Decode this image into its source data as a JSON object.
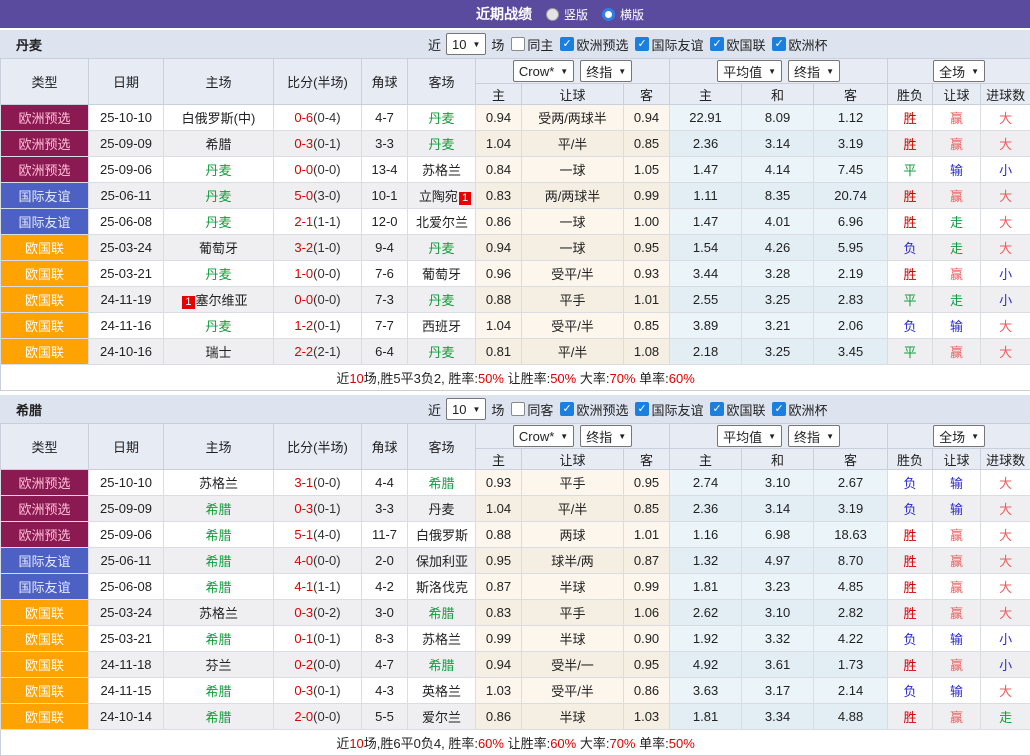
{
  "topbar": {
    "title": "近期战绩",
    "vertical_label": "竖版",
    "horizontal_label": "横版",
    "selected_layout": "横版"
  },
  "filter": {
    "near": "近",
    "count": "10",
    "games": "场",
    "leagues": [
      "欧洲预选",
      "国际友谊",
      "欧国联",
      "欧洲杯"
    ],
    "leagues_checked": [
      true,
      true,
      true,
      true
    ]
  },
  "dropdowns": {
    "source": "Crow*",
    "final": "终指",
    "average": "平均值",
    "final2": "终指",
    "scope": "全场"
  },
  "columns": {
    "type": "类型",
    "date": "日期",
    "home": "主场",
    "score": "比分(半场)",
    "corner": "角球",
    "away": "客场",
    "home_odds": "主",
    "handicap": "让球",
    "away_odds": "客",
    "avg_home": "主",
    "avg_draw": "和",
    "avg_away": "客",
    "result": "胜负",
    "handicap_result": "让球",
    "goals": "进球数"
  },
  "colors": {
    "accent_purple": "#5b4b9e",
    "type_preselect": "#8c1a52",
    "type_friendly": "#4c61c3",
    "type_nations": "#ffa302",
    "win_red": "#d30000",
    "soft_red": "#ed5f5f",
    "lose_blue": "#2a2ace",
    "draw_green": "#0f9e3c",
    "checkbox_blue": "#1b7fe0"
  },
  "sections": [
    {
      "team": "丹麦",
      "same_venue_label": "同主",
      "same_venue_checked": false,
      "rows": [
        {
          "type": "欧洲预选",
          "tc": "ps",
          "date": "25-10-10",
          "home": "白俄罗斯(中)",
          "hg": 0,
          "score": "0-6",
          "half": "(0-4)",
          "corner": "4-7",
          "away": "丹麦",
          "ag": 1,
          "o1": "0.94",
          "line": "受两/两球半",
          "o2": "0.94",
          "m1": "22.91",
          "m2": "8.09",
          "m3": "1.12",
          "res": [
            "胜",
            "red"
          ],
          "hres": [
            "赢",
            "pink"
          ],
          "goal": [
            "大",
            "pink"
          ]
        },
        {
          "type": "欧洲预选",
          "tc": "ps",
          "date": "25-09-09",
          "home": "希腊",
          "hg": 0,
          "score": "0-3",
          "half": "(0-1)",
          "corner": "3-3",
          "away": "丹麦",
          "ag": 1,
          "o1": "1.04",
          "line": "平/半",
          "o2": "0.85",
          "m1": "2.36",
          "m2": "3.14",
          "m3": "3.19",
          "res": [
            "胜",
            "red"
          ],
          "hres": [
            "赢",
            "pink"
          ],
          "goal": [
            "大",
            "pink"
          ]
        },
        {
          "type": "欧洲预选",
          "tc": "ps",
          "date": "25-09-06",
          "home": "丹麦",
          "hg": 1,
          "score": "0-0",
          "half": "(0-0)",
          "corner": "13-4",
          "away": "苏格兰",
          "ag": 0,
          "o1": "0.84",
          "line": "一球",
          "o2": "1.05",
          "m1": "1.47",
          "m2": "4.14",
          "m3": "7.45",
          "res": [
            "平",
            "green"
          ],
          "hres": [
            "输",
            "blue"
          ],
          "goal": [
            "小",
            "blue"
          ]
        },
        {
          "type": "国际友谊",
          "tc": "fr",
          "date": "25-06-11",
          "home": "丹麦",
          "hg": 1,
          "score": "5-0",
          "half": "(3-0)",
          "corner": "10-1",
          "away": "立陶宛",
          "ag": 0,
          "ab": "1",
          "abp": "after",
          "o1": "0.83",
          "line": "两/两球半",
          "o2": "0.99",
          "m1": "1.11",
          "m2": "8.35",
          "m3": "20.74",
          "res": [
            "胜",
            "red"
          ],
          "hres": [
            "赢",
            "pink"
          ],
          "goal": [
            "大",
            "pink"
          ]
        },
        {
          "type": "国际友谊",
          "tc": "fr",
          "date": "25-06-08",
          "home": "丹麦",
          "hg": 1,
          "score": "2-1",
          "half": "(1-1)",
          "corner": "12-0",
          "away": "北爱尔兰",
          "ag": 0,
          "o1": "0.86",
          "line": "一球",
          "o2": "1.00",
          "m1": "1.47",
          "m2": "4.01",
          "m3": "6.96",
          "res": [
            "胜",
            "red"
          ],
          "hres": [
            "走",
            "green"
          ],
          "goal": [
            "大",
            "pink"
          ]
        },
        {
          "type": "欧国联",
          "tc": "nl",
          "date": "25-03-24",
          "home": "葡萄牙",
          "hg": 0,
          "score": "3-2",
          "half": "(1-0)",
          "corner": "9-4",
          "away": "丹麦",
          "ag": 1,
          "o1": "0.94",
          "line": "一球",
          "o2": "0.95",
          "m1": "1.54",
          "m2": "4.26",
          "m3": "5.95",
          "res": [
            "负",
            "blue"
          ],
          "hres": [
            "走",
            "green"
          ],
          "goal": [
            "大",
            "pink"
          ]
        },
        {
          "type": "欧国联",
          "tc": "nl",
          "date": "25-03-21",
          "home": "丹麦",
          "hg": 1,
          "score": "1-0",
          "half": "(0-0)",
          "corner": "7-6",
          "away": "葡萄牙",
          "ag": 0,
          "o1": "0.96",
          "line": "受平/半",
          "o2": "0.93",
          "m1": "3.44",
          "m2": "3.28",
          "m3": "2.19",
          "res": [
            "胜",
            "red"
          ],
          "hres": [
            "赢",
            "pink"
          ],
          "goal": [
            "小",
            "blue"
          ]
        },
        {
          "type": "欧国联",
          "tc": "nl",
          "date": "24-11-19",
          "home": "塞尔维亚",
          "hg": 0,
          "hb": "1",
          "hbp": "before",
          "score": "0-0",
          "half": "(0-0)",
          "corner": "7-3",
          "away": "丹麦",
          "ag": 1,
          "o1": "0.88",
          "line": "平手",
          "o2": "1.01",
          "m1": "2.55",
          "m2": "3.25",
          "m3": "2.83",
          "res": [
            "平",
            "green"
          ],
          "hres": [
            "走",
            "green"
          ],
          "goal": [
            "小",
            "blue"
          ]
        },
        {
          "type": "欧国联",
          "tc": "nl",
          "date": "24-11-16",
          "home": "丹麦",
          "hg": 1,
          "score": "1-2",
          "half": "(0-1)",
          "corner": "7-7",
          "away": "西班牙",
          "ag": 0,
          "o1": "1.04",
          "line": "受平/半",
          "o2": "0.85",
          "m1": "3.89",
          "m2": "3.21",
          "m3": "2.06",
          "res": [
            "负",
            "blue"
          ],
          "hres": [
            "输",
            "blue"
          ],
          "goal": [
            "大",
            "pink"
          ]
        },
        {
          "type": "欧国联",
          "tc": "nl",
          "date": "24-10-16",
          "home": "瑞士",
          "hg": 0,
          "score": "2-2",
          "half": "(2-1)",
          "corner": "6-4",
          "away": "丹麦",
          "ag": 1,
          "o1": "0.81",
          "line": "平/半",
          "o2": "1.08",
          "m1": "2.18",
          "m2": "3.25",
          "m3": "3.45",
          "res": [
            "平",
            "green"
          ],
          "hres": [
            "赢",
            "pink"
          ],
          "goal": [
            "大",
            "pink"
          ]
        }
      ],
      "summary": [
        [
          "近",
          "k"
        ],
        [
          "10",
          "r"
        ],
        [
          "场,胜5平3负2, 胜率:",
          "k"
        ],
        [
          "50%",
          "r"
        ],
        [
          " 让胜率:",
          "k"
        ],
        [
          "50%",
          "r"
        ],
        [
          " 大率:",
          "k"
        ],
        [
          "70%",
          "r"
        ],
        [
          " 单率:",
          "k"
        ],
        [
          "60%",
          "r"
        ]
      ]
    },
    {
      "team": "希腊",
      "same_venue_label": "同客",
      "same_venue_checked": false,
      "rows": [
        {
          "type": "欧洲预选",
          "tc": "ps",
          "date": "25-10-10",
          "home": "苏格兰",
          "hg": 0,
          "score": "3-1",
          "half": "(0-0)",
          "corner": "4-4",
          "away": "希腊",
          "ag": 1,
          "o1": "0.93",
          "line": "平手",
          "o2": "0.95",
          "m1": "2.74",
          "m2": "3.10",
          "m3": "2.67",
          "res": [
            "负",
            "blue"
          ],
          "hres": [
            "输",
            "blue"
          ],
          "goal": [
            "大",
            "pink"
          ]
        },
        {
          "type": "欧洲预选",
          "tc": "ps",
          "date": "25-09-09",
          "home": "希腊",
          "hg": 1,
          "score": "0-3",
          "half": "(0-1)",
          "corner": "3-3",
          "away": "丹麦",
          "ag": 0,
          "o1": "1.04",
          "line": "平/半",
          "o2": "0.85",
          "m1": "2.36",
          "m2": "3.14",
          "m3": "3.19",
          "res": [
            "负",
            "blue"
          ],
          "hres": [
            "输",
            "blue"
          ],
          "goal": [
            "大",
            "pink"
          ]
        },
        {
          "type": "欧洲预选",
          "tc": "ps",
          "date": "25-09-06",
          "home": "希腊",
          "hg": 1,
          "score": "5-1",
          "half": "(4-0)",
          "corner": "11-7",
          "away": "白俄罗斯",
          "ag": 0,
          "o1": "0.88",
          "line": "两球",
          "o2": "1.01",
          "m1": "1.16",
          "m2": "6.98",
          "m3": "18.63",
          "res": [
            "胜",
            "red"
          ],
          "hres": [
            "赢",
            "pink"
          ],
          "goal": [
            "大",
            "pink"
          ]
        },
        {
          "type": "国际友谊",
          "tc": "fr",
          "date": "25-06-11",
          "home": "希腊",
          "hg": 1,
          "score": "4-0",
          "half": "(0-0)",
          "corner": "2-0",
          "away": "保加利亚",
          "ag": 0,
          "o1": "0.95",
          "line": "球半/两",
          "o2": "0.87",
          "m1": "1.32",
          "m2": "4.97",
          "m3": "8.70",
          "res": [
            "胜",
            "red"
          ],
          "hres": [
            "赢",
            "pink"
          ],
          "goal": [
            "大",
            "pink"
          ]
        },
        {
          "type": "国际友谊",
          "tc": "fr",
          "date": "25-06-08",
          "home": "希腊",
          "hg": 1,
          "score": "4-1",
          "half": "(1-1)",
          "corner": "4-2",
          "away": "斯洛伐克",
          "ag": 0,
          "o1": "0.87",
          "line": "半球",
          "o2": "0.99",
          "m1": "1.81",
          "m2": "3.23",
          "m3": "4.85",
          "res": [
            "胜",
            "red"
          ],
          "hres": [
            "赢",
            "pink"
          ],
          "goal": [
            "大",
            "pink"
          ]
        },
        {
          "type": "欧国联",
          "tc": "nl",
          "date": "25-03-24",
          "home": "苏格兰",
          "hg": 0,
          "score": "0-3",
          "half": "(0-2)",
          "corner": "3-0",
          "away": "希腊",
          "ag": 1,
          "o1": "0.83",
          "line": "平手",
          "o2": "1.06",
          "m1": "2.62",
          "m2": "3.10",
          "m3": "2.82",
          "res": [
            "胜",
            "red"
          ],
          "hres": [
            "赢",
            "pink"
          ],
          "goal": [
            "大",
            "pink"
          ]
        },
        {
          "type": "欧国联",
          "tc": "nl",
          "date": "25-03-21",
          "home": "希腊",
          "hg": 1,
          "score": "0-1",
          "half": "(0-1)",
          "corner": "8-3",
          "away": "苏格兰",
          "ag": 0,
          "o1": "0.99",
          "line": "半球",
          "o2": "0.90",
          "m1": "1.92",
          "m2": "3.32",
          "m3": "4.22",
          "res": [
            "负",
            "blue"
          ],
          "hres": [
            "输",
            "blue"
          ],
          "goal": [
            "小",
            "blue"
          ]
        },
        {
          "type": "欧国联",
          "tc": "nl",
          "date": "24-11-18",
          "home": "芬兰",
          "hg": 0,
          "score": "0-2",
          "half": "(0-0)",
          "corner": "4-7",
          "away": "希腊",
          "ag": 1,
          "o1": "0.94",
          "line": "受半/一",
          "o2": "0.95",
          "m1": "4.92",
          "m2": "3.61",
          "m3": "1.73",
          "res": [
            "胜",
            "red"
          ],
          "hres": [
            "赢",
            "pink"
          ],
          "goal": [
            "小",
            "blue"
          ]
        },
        {
          "type": "欧国联",
          "tc": "nl",
          "date": "24-11-15",
          "home": "希腊",
          "hg": 1,
          "score": "0-3",
          "half": "(0-1)",
          "corner": "4-3",
          "away": "英格兰",
          "ag": 0,
          "o1": "1.03",
          "line": "受平/半",
          "o2": "0.86",
          "m1": "3.63",
          "m2": "3.17",
          "m3": "2.14",
          "res": [
            "负",
            "blue"
          ],
          "hres": [
            "输",
            "blue"
          ],
          "goal": [
            "大",
            "pink"
          ]
        },
        {
          "type": "欧国联",
          "tc": "nl",
          "date": "24-10-14",
          "home": "希腊",
          "hg": 1,
          "score": "2-0",
          "half": "(0-0)",
          "corner": "5-5",
          "away": "爱尔兰",
          "ag": 0,
          "o1": "0.86",
          "line": "半球",
          "o2": "1.03",
          "m1": "1.81",
          "m2": "3.34",
          "m3": "4.88",
          "res": [
            "胜",
            "red"
          ],
          "hres": [
            "赢",
            "pink"
          ],
          "goal": [
            "走",
            "green"
          ]
        }
      ],
      "summary": [
        [
          "近",
          "k"
        ],
        [
          "10",
          "r"
        ],
        [
          "场,胜6平0负4, 胜率:",
          "k"
        ],
        [
          "60%",
          "r"
        ],
        [
          " 让胜率:",
          "k"
        ],
        [
          "60%",
          "r"
        ],
        [
          " 大率:",
          "k"
        ],
        [
          "70%",
          "r"
        ],
        [
          " 单率:",
          "k"
        ],
        [
          "50%",
          "r"
        ]
      ]
    }
  ]
}
